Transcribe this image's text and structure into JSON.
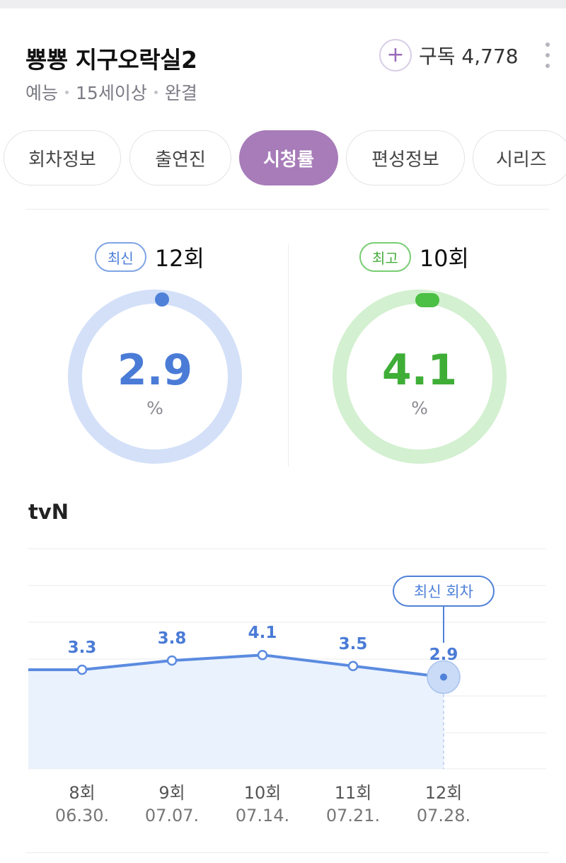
{
  "header": {
    "title": "뿅뿅 지구오락실2",
    "genre": "예능",
    "age_rating": "15세이상",
    "status": "완결",
    "subscribe_label": "구독 4,778"
  },
  "tabs": [
    {
      "label": "회차정보",
      "active": false
    },
    {
      "label": "출연진",
      "active": false
    },
    {
      "label": "시청률",
      "active": true
    },
    {
      "label": "편성정보",
      "active": false
    },
    {
      "label": "시리즈",
      "active": false
    }
  ],
  "ratings": {
    "latest": {
      "badge": "최신",
      "episode": "12회",
      "value": "2.9",
      "unit": "%"
    },
    "best": {
      "badge": "최고",
      "episode": "10회",
      "value": "4.1",
      "unit": "%"
    }
  },
  "chart_section": {
    "network": "tvN",
    "latest_tag": "최신 회차"
  },
  "colors": {
    "accent_purple": "#a77cb9",
    "latest_blue": "#4f81d8",
    "best_green": "#45ad3d"
  },
  "chart_data": {
    "type": "area",
    "categories": [
      "8회",
      "9회",
      "10회",
      "11회",
      "12회"
    ],
    "dates": [
      "06.30.",
      "07.07.",
      "07.14.",
      "07.21.",
      "07.28."
    ],
    "values": [
      3.3,
      3.8,
      4.1,
      3.5,
      2.9
    ],
    "data_labels": [
      "3.3",
      "3.8",
      "4.1",
      "3.5",
      "2.9"
    ],
    "series": [
      {
        "values": [
          3.3,
          3.8,
          4.1,
          3.5,
          2.9
        ]
      }
    ],
    "highlighted": "12회",
    "grid": true
  }
}
